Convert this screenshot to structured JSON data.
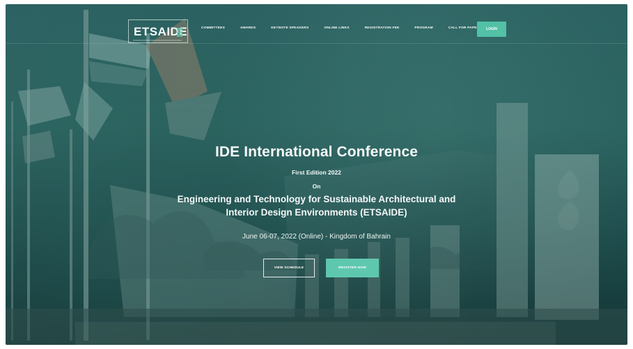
{
  "site": {
    "brand": "ETSAIDE"
  },
  "nav": {
    "items": [
      "COMMITTEES",
      "AWARDS",
      "KEYNOTE SPEAKERS",
      "ONLINE LINKS",
      "REGISTRATION FEE",
      "PROGRAM",
      "CALL FOR PAPER"
    ],
    "login_label": "LOGIN"
  },
  "hero": {
    "title": "IDE International Conference",
    "edition": "First Edition 2022",
    "on": "On",
    "subtitle": "Engineering and Technology for Sustainable Architectural and Interior Design Environments (ETSAIDE)",
    "date_location": "June 06-07, 2022 (Online) - Kingdom of Bahrain",
    "buttons": {
      "schedule": "VIEW SCHEDULE",
      "register": "REGISTER NOW"
    }
  },
  "colors": {
    "overlay": "#2a6562",
    "accent": "#52c1a6",
    "text": "#f4f8f7"
  }
}
